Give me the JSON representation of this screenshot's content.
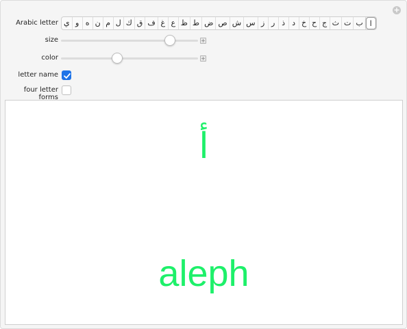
{
  "controls": {
    "arabic_letter_label": "Arabic letter",
    "size_label": "size",
    "color_label": "color",
    "letter_name_label": "letter name",
    "four_forms_label": "four letter forms",
    "letters": [
      "ي",
      "و",
      "ه",
      "ن",
      "م",
      "ل",
      "ك",
      "ق",
      "ف",
      "غ",
      "ع",
      "ظ",
      "ط",
      "ض",
      "ص",
      "ش",
      "س",
      "ز",
      "ر",
      "ذ",
      "د",
      "خ",
      "ح",
      "ج",
      "ث",
      "ت",
      "ب",
      "ا"
    ],
    "selected_letter": "ا",
    "size_value": 0.82,
    "color_value": 0.4,
    "letter_name_checked": true,
    "four_forms_checked": false
  },
  "display": {
    "glyph": "أ",
    "name": "aleph",
    "text_color": "#1ef06a"
  },
  "icons": {
    "corner": "plus-circle-icon",
    "size_plus": "plus-square-icon",
    "color_plus": "plus-square-icon",
    "check": "checkmark-icon"
  }
}
